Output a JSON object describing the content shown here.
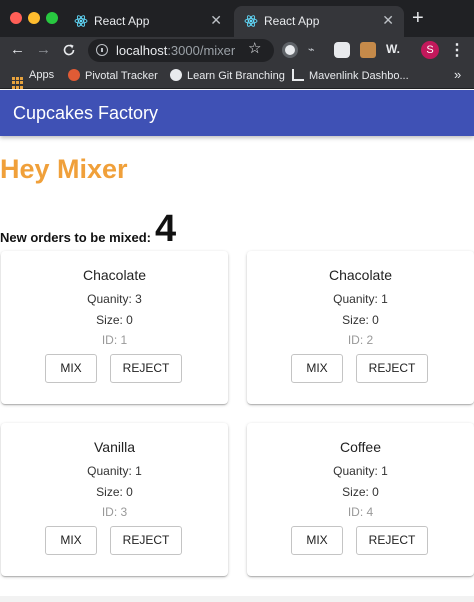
{
  "browser": {
    "tabs": [
      {
        "title": "React App",
        "active": false
      },
      {
        "title": "React App",
        "active": true
      }
    ],
    "new_tab_label": "+",
    "close_label": "✕",
    "url_host": "localhost",
    "url_path": ":3000/mixer",
    "profile_initial": "S",
    "bookmarks": [
      "Apps",
      "Pivotal Tracker",
      "Learn Git Branching",
      "Mavenlink Dashbo..."
    ],
    "bookmarks_more": "»"
  },
  "app": {
    "title": "Cupcakes Factory",
    "bar_color": "#3f51b5"
  },
  "page": {
    "heading": "Hey Mixer",
    "heading_color": "#f0a03a",
    "orders_label": "New orders to be mixed:",
    "orders_count": "4"
  },
  "orders": [
    {
      "flavor": "Chacolate",
      "quantity": "Quanity: 3",
      "size": "Size: 0",
      "id": "ID: 1",
      "mix_label": "MIX",
      "reject_label": "REJECT"
    },
    {
      "flavor": "Chacolate",
      "quantity": "Quanity: 1",
      "size": "Size: 0",
      "id": "ID: 2",
      "mix_label": "MIX",
      "reject_label": "REJECT"
    },
    {
      "flavor": "Vanilla",
      "quantity": "Quanity: 1",
      "size": "Size: 0",
      "id": "ID: 3",
      "mix_label": "MIX",
      "reject_label": "REJECT"
    },
    {
      "flavor": "Coffee",
      "quantity": "Quanity: 1",
      "size": "Size: 0",
      "id": "ID: 4",
      "mix_label": "MIX",
      "reject_label": "REJECT"
    }
  ]
}
